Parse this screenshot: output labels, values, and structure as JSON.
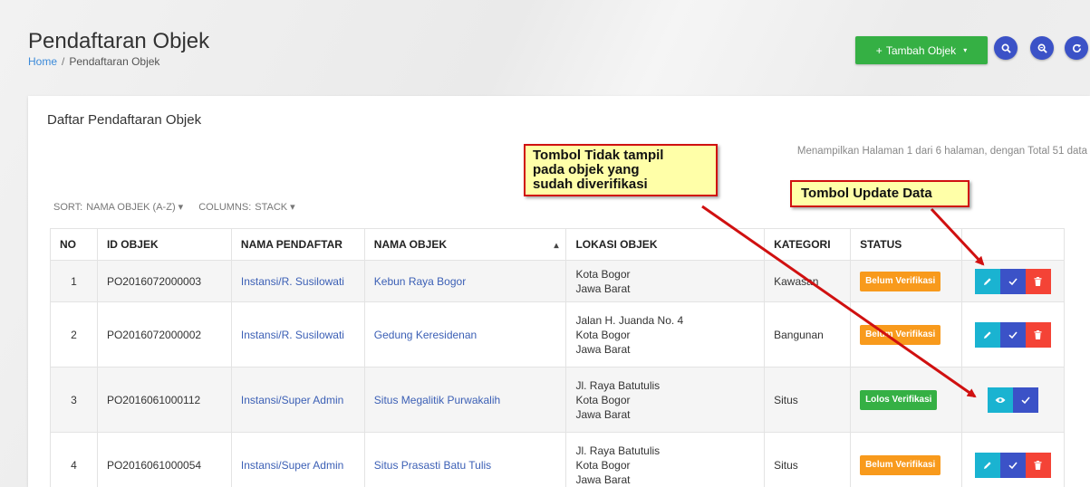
{
  "header": {
    "title": "Pendaftaran Objek",
    "breadcrumb": {
      "home": "Home",
      "separator": "/",
      "current": "Pendaftaran Objek"
    },
    "add_button": {
      "icon": "+",
      "label": "Tambah Objek",
      "caret": "▾"
    },
    "tool_buttons": [
      {
        "name": "search-icon",
        "glyph": "⚲"
      },
      {
        "name": "advanced-search-icon",
        "glyph": "⚲"
      },
      {
        "name": "refresh-icon",
        "glyph": "↻"
      }
    ]
  },
  "card": {
    "title": "Daftar Pendaftaran Objek",
    "page_info": "Menampilkan Halaman 1 dari 6 halaman, dengan Total 51 data",
    "sort_label": "SORT:",
    "sort_value": "NAMA OBJEK (A-Z)",
    "sort_caret": "▾",
    "columns_label": "COLUMNS:",
    "columns_value": "STACK",
    "columns_caret": "▾"
  },
  "table": {
    "headers": [
      "NO",
      "ID OBJEK",
      "NAMA PENDAFTAR",
      "NAMA OBJEK",
      "LOKASI OBJEK",
      "KATEGORI",
      "STATUS"
    ],
    "sort_indicator": "▴",
    "rows": [
      {
        "no": "1",
        "id": "PO2016072000003",
        "pendaftar": "Instansi/R. Susilowati",
        "objek": "Kebun Raya Bogor",
        "lokasi": [
          "Kota Bogor",
          "Jawa Barat"
        ],
        "kategori": "Kawasan",
        "status": "Belum Verifikasi",
        "status_type": "orange"
      },
      {
        "no": "2",
        "id": "PO2016072000002",
        "pendaftar": "Instansi/R. Susilowati",
        "objek": "Gedung Keresidenan",
        "lokasi": [
          "Jalan H. Juanda No. 4",
          "Kota Bogor",
          "Jawa Barat"
        ],
        "kategori": "Bangunan",
        "status": "Belum Verifikasi",
        "status_type": "orange"
      },
      {
        "no": "3",
        "id": "PO2016061000112",
        "pendaftar": "Instansi/Super Admin",
        "objek": "Situs Megalitik Purwakalih",
        "lokasi": [
          "Jl. Raya Batutulis",
          "Kota Bogor",
          "Jawa Barat"
        ],
        "kategori": "Situs",
        "status": "Lolos Verifikasi",
        "status_type": "green"
      },
      {
        "no": "4",
        "id": "PO2016061000054",
        "pendaftar": "Instansi/Super Admin",
        "objek": "Situs Prasasti Batu Tulis",
        "lokasi": [
          "Jl. Raya Batutulis",
          "Kota Bogor",
          "Jawa Barat"
        ],
        "kategori": "Situs",
        "status": "Belum Verifikasi",
        "status_type": "orange"
      }
    ]
  },
  "annotations": {
    "callout_hidden": [
      "Tombol Tidak tampil",
      "pada objek yang",
      "sudah diverifikasi"
    ],
    "callout_update": "Tombol Update Data"
  },
  "colors": {
    "accent_blue": "#3b52c7",
    "success_green": "#35b044",
    "warning_orange": "#f89a1c",
    "danger_red": "#f44336",
    "info_cyan": "#1ab3d1",
    "callout_border": "#d01010"
  }
}
